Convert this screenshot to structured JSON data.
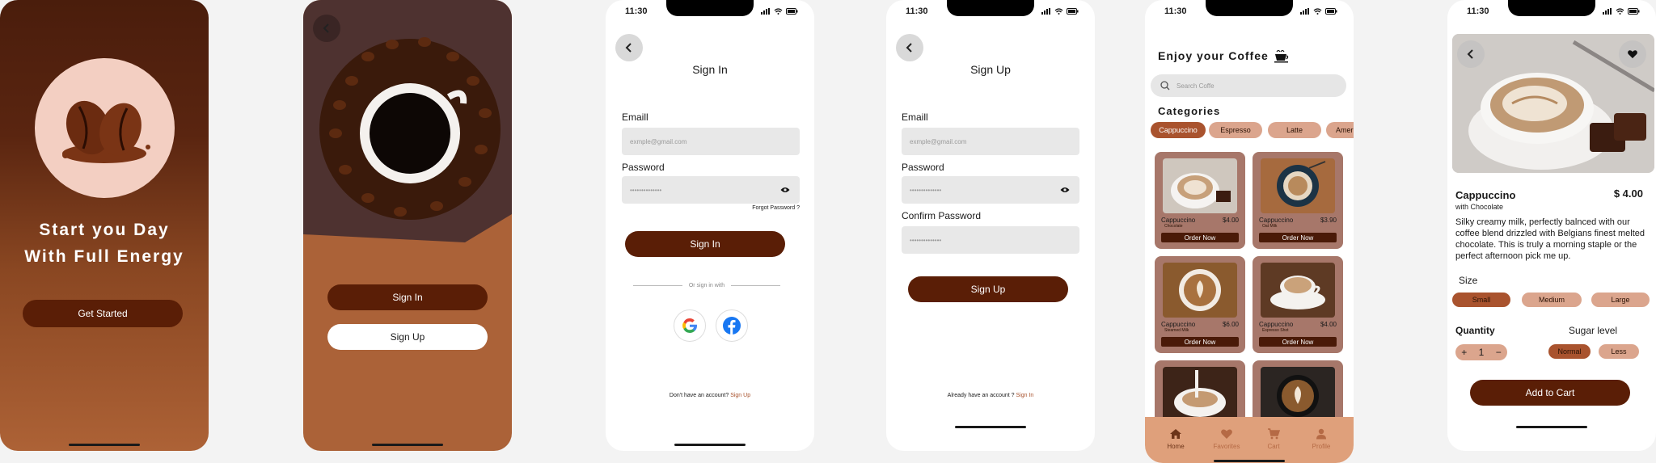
{
  "splash": {
    "headline_line1": "Start you Day",
    "headline_line2": "With Full Energy",
    "cta": "Get Started"
  },
  "welcome": {
    "sign_in": "Sign In",
    "sign_up": "Sign Up"
  },
  "signin": {
    "time": "11:30",
    "title": "Sign In",
    "email_label": "Emaill",
    "email_placeholder": "exmple@gmail.com",
    "password_label": "Password",
    "password_value": "••••••••••••••",
    "forgot": "Forgot Password ?",
    "button": "Sign In",
    "divider": "Or sign in with",
    "footer_prefix": "Don't have an account?",
    "footer_link": "Sign Up"
  },
  "signup": {
    "time": "11:30",
    "title": "Sign Up",
    "email_label": "Emaill",
    "email_placeholder": "exmple@gmail.com",
    "password_label": "Password",
    "password_value": "••••••••••••••",
    "confirm_label": "Confirm Password",
    "confirm_value": "••••••••••••••",
    "button": "Sign Up",
    "footer_prefix": "Already have an account ?",
    "footer_link": "Sign In"
  },
  "home": {
    "time": "11:30",
    "header": "Enjoy your Coffee",
    "search_placeholder": "Search Coffe",
    "categories_title": "Categories",
    "categories": [
      "Cappuccino",
      "Espresso",
      "Latte",
      "Amer"
    ],
    "order_label": "Order Now",
    "cards": [
      {
        "name": "Cappuccino",
        "sub": "Chocolate",
        "price": "$4.00"
      },
      {
        "name": "Cappuccino",
        "sub": "Oat Milk",
        "price": "$3.90"
      },
      {
        "name": "Cappuccino",
        "sub": "Steamed Milk",
        "price": "$6.00"
      },
      {
        "name": "Cappuccino",
        "sub": "Espresso Shot",
        "price": "$4.00"
      }
    ],
    "nav": [
      "Home",
      "Favorites",
      "Cart",
      "Profile"
    ]
  },
  "detail": {
    "time": "11:30",
    "name": "Cappuccino",
    "subtitle": "with Chocolate",
    "price": "$ 4.00",
    "description": "Silky creamy milk, perfectly balnced with our coffee blend drizzled with Belgians finest melted chocolate. This is truly a morning staple or the perfect afternoon pick me up.",
    "size_label": "Size",
    "sizes": [
      "Small",
      "Medium",
      "Large"
    ],
    "quantity_label": "Quantity",
    "quantity": "1",
    "sugar_label": "Sugar level",
    "sugar": [
      "Normal",
      "Less"
    ],
    "cta": "Add to Cart"
  },
  "colors": {
    "brown_dark": "#5a1e06",
    "accent": "#a9532e",
    "chip_light": "#dba58d",
    "nav_bg": "#dfa07b"
  }
}
